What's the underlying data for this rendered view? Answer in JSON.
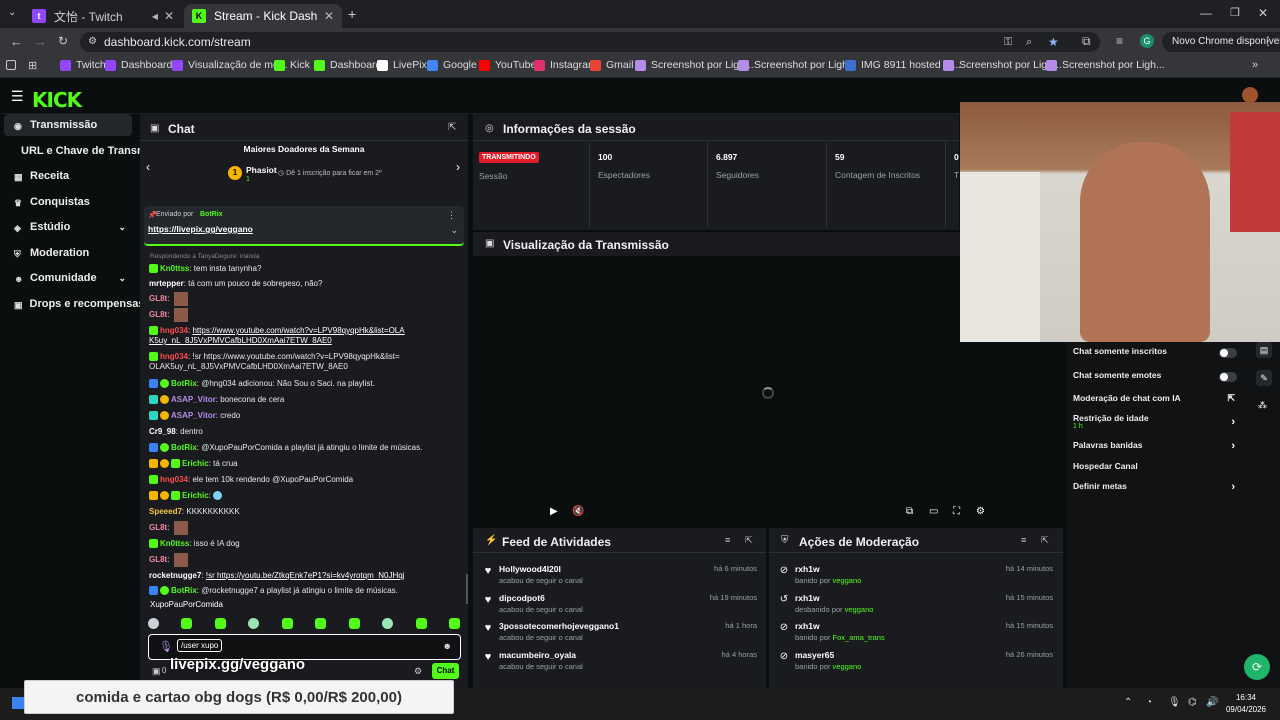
{
  "browser": {
    "tabs": [
      {
        "label": "文怡 - Twitch",
        "favicon": "twitch-icon"
      },
      {
        "label": "Stream - Kick Dashboard",
        "favicon": "kick-icon"
      }
    ],
    "url": "dashboard.kick.com/stream",
    "update_button": "Novo Chrome disponível",
    "profile_initial": "G",
    "bookmarks": [
      {
        "label": "Twitch",
        "color": "#9146ff"
      },
      {
        "label": "Dashboard",
        "color": "#9146ff"
      },
      {
        "label": "Visualização de mo...",
        "color": "#9146ff"
      },
      {
        "label": "Kick",
        "color": "#53fc18"
      },
      {
        "label": "Dashboard",
        "color": "#53fc18"
      },
      {
        "label": "LivePix",
        "color": "#ffffff"
      },
      {
        "label": "Google",
        "color": "#4285f4"
      },
      {
        "label": "YouTube",
        "color": "#ff0000"
      },
      {
        "label": "Instagram",
        "color": "#e1306c"
      },
      {
        "label": "Gmail",
        "color": "#ea4335"
      },
      {
        "label": "Screenshot por Ligh...",
        "color": "#b48be8"
      },
      {
        "label": "Screenshot por Ligh...",
        "color": "#b48be8"
      },
      {
        "label": "IMG 8911 hosted at...",
        "color": "#3b6fd1"
      },
      {
        "label": "Screenshot por Ligh...",
        "color": "#b48be8"
      },
      {
        "label": "Screenshot por Ligh...",
        "color": "#b48be8"
      }
    ]
  },
  "logo": "KICK",
  "sidebar": {
    "items": [
      {
        "label": "Transmissão",
        "icon": "broadcast-icon",
        "active": true
      },
      {
        "label": "URL e Chave de Transmissão",
        "icon": "",
        "active": false
      },
      {
        "label": "Receita",
        "icon": "revenue-icon",
        "active": false
      },
      {
        "label": "Conquistas",
        "icon": "trophy-icon",
        "active": false
      },
      {
        "label": "Estúdio",
        "icon": "studio-icon",
        "active": false
      },
      {
        "label": "Moderation",
        "icon": "shield-icon",
        "active": false
      },
      {
        "label": "Comunidade",
        "icon": "community-icon",
        "active": false
      },
      {
        "label": "Drops e recompensas",
        "icon": "drops-icon",
        "active": false
      }
    ]
  },
  "chat": {
    "title": "Chat",
    "top_donors_title": "Maiores Doadores da Semana",
    "donor_rank": "1",
    "donor_name": "Phasiot",
    "donor_sub": "1",
    "donor_hint": "Dê 1 inscrição para ficar em 2º",
    "pinned_sender_prefix": "Enviado por",
    "pinned_sender": "BotRix",
    "pinned_link": "https://livepix.gg/veggano",
    "reply_hint": "Respondendo a TanyaDegure: irlanda",
    "messages": [
      {
        "user": "Kn0ttss",
        "color": "#53fc18",
        "text": "tem insta tanynha?"
      },
      {
        "user": "mrtepper",
        "color": "#ffffff",
        "text": "tá com um pouco de sobrepeso, não?"
      },
      {
        "user": "GL8t",
        "color": "#f08aa0",
        "text": ""
      },
      {
        "user": "GL8t",
        "color": "#f08aa0",
        "text": ""
      },
      {
        "user": "hng034",
        "color": "#ff4d4d",
        "text": "https://www.youtube.com/watch?v=LPV98qyqpHk&list=OLAK5uy_nL_8J5VxPMVCafbLHD0XmAai7ETW_8AE0"
      },
      {
        "user": "hng034",
        "color": "#ff4d4d",
        "text": "!sr https://www.youtube.com/watch?v=LPV98qyqpHk&list=OLAK5uy_nL_8J5VxPMVCafbLHD0XmAai7ETW_8AE0"
      },
      {
        "user": "BotRix",
        "color": "#53fc18",
        "text": "@hng034 adicionou: Não Sou o Saci. na playlist."
      },
      {
        "user": "ASAP_Vitor",
        "color": "#b48be8",
        "text": "bonecona de cera"
      },
      {
        "user": "ASAP_Vitor",
        "color": "#b48be8",
        "text": "credo"
      },
      {
        "user": "Cr9_98",
        "color": "#ffffff",
        "text": "dentro"
      },
      {
        "user": "BotRix",
        "color": "#53fc18",
        "text": "@XupoPauPorComida a playlist já atingiu o limite de músicas."
      },
      {
        "user": "Erichic",
        "color": "#53fc18",
        "text": "tá crua"
      },
      {
        "user": "hng034",
        "color": "#ff4d4d",
        "text": "ele tem 10k rendendo @XupoPauPorComida"
      },
      {
        "user": "Erichic",
        "color": "#53fc18",
        "text": ""
      },
      {
        "user": "Speeed7",
        "color": "#f5c542",
        "text": "KKKKKKKKKK"
      },
      {
        "user": "GL8t",
        "color": "#f08aa0",
        "text": ""
      },
      {
        "user": "Kn0ttss",
        "color": "#53fc18",
        "text": "isso é IA dog"
      },
      {
        "user": "GL8t",
        "color": "#f08aa0",
        "text": ""
      },
      {
        "user": "rocketnugge7",
        "color": "#ffffff",
        "text": "!sr https://youtu.be/ZtkqEnk7eP1?si=kv4yrotqm_N0JHqj"
      },
      {
        "user": "BotRix",
        "color": "#53fc18",
        "text": "@rocketnugge7 a playlist já atingiu o limite de músicas."
      }
    ],
    "mention_user": "XupoPauPorComida",
    "input_value": "/user xupo",
    "chat_button": "Chat",
    "viewer_count": "0"
  },
  "overlay": {
    "livepix_text": "livepix.gg/veggano",
    "goal_text": "comida e cartao obg dogs (R$ 0,00/R$ 200,00)"
  },
  "session": {
    "title": "Informações da sessão",
    "live_badge": "TRANSMITINDO",
    "session_label": "Sessão",
    "stats": [
      {
        "value": "100",
        "label": "Espectadores"
      },
      {
        "value": "6.897",
        "label": "Seguidores"
      },
      {
        "value": "59",
        "label": "Contagem de Inscritos"
      },
      {
        "value": "0",
        "label": "T"
      }
    ]
  },
  "preview": {
    "title": "Visualização da Transmissão"
  },
  "feed": {
    "title": "Feed de Atividades",
    "items": [
      {
        "name": "Hollywood4I20I",
        "sub": "acabou de seguir o canal",
        "time": "há 6 minutos"
      },
      {
        "name": "dipcodpot6",
        "sub": "acabou de seguir o canal",
        "time": "há 19 minutos"
      },
      {
        "name": "3possotecomerhojeveggano1",
        "sub": "acabou de seguir o canal",
        "time": "há 1 hora"
      },
      {
        "name": "macumbeiro_oyala",
        "sub": "acabou de seguir o canal",
        "time": "há 4 horas"
      }
    ]
  },
  "moderation": {
    "title": "Ações de Moderação",
    "items": [
      {
        "name": "rxh1w",
        "action": "banido por",
        "by": "veggano",
        "time": "há 14 minutos",
        "icon": "ban-icon"
      },
      {
        "name": "rxh1w",
        "action": "desbanido por",
        "by": "veggano",
        "time": "há 15 minutos",
        "icon": "undo-icon"
      },
      {
        "name": "rxh1w",
        "action": "banido por",
        "by": "Fox_ama_trans",
        "time": "há 15 minutos",
        "icon": "ban-icon"
      },
      {
        "name": "masyer65",
        "action": "banido por",
        "by": "veggano",
        "time": "há 26 minutos",
        "icon": "ban-icon"
      }
    ]
  },
  "chat_settings": {
    "rows": [
      {
        "label": "Chat somente inscritos",
        "type": "toggle"
      },
      {
        "label": "Chat somente emotes",
        "type": "toggle"
      },
      {
        "label": "Moderação de chat com IA",
        "type": "external"
      },
      {
        "label": "Restrição de idade",
        "sub": "1 h",
        "type": "chevron"
      },
      {
        "label": "Palavras banidas",
        "type": "chevron"
      },
      {
        "label": "Hospedar Canal",
        "type": "none"
      },
      {
        "label": "Definir metas",
        "type": "chevron"
      }
    ]
  },
  "taskbar": {
    "time": "16:34",
    "date": "09/04/2026"
  }
}
